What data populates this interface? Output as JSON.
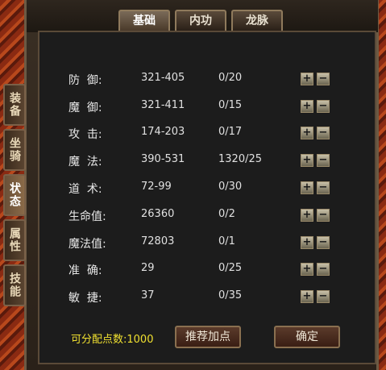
{
  "tabs": [
    "基础",
    "内功",
    "龙脉"
  ],
  "side_tabs": [
    "装备",
    "坐骑",
    "状态",
    "属性",
    "技能"
  ],
  "stats": [
    {
      "label": "防  御:",
      "value": "321-405",
      "points": "0/20"
    },
    {
      "label": "魔  御:",
      "value": "321-411",
      "points": "0/15"
    },
    {
      "label": "攻  击:",
      "value": "174-203",
      "points": "0/17"
    },
    {
      "label": "魔  法:",
      "value": "390-531",
      "points": "1320/25"
    },
    {
      "label": "道  术:",
      "value": "72-99",
      "points": "0/30"
    },
    {
      "label": "生命值:",
      "value": "26360",
      "points": "0/2"
    },
    {
      "label": "魔法值:",
      "value": "72803",
      "points": "0/1"
    },
    {
      "label": "准  确:",
      "value": "29",
      "points": "0/25"
    },
    {
      "label": "敏  捷:",
      "value": "37",
      "points": "0/35"
    }
  ],
  "buttons": {
    "plus": "+",
    "minus": "−",
    "recommend": "推荐加点",
    "confirm": "确定"
  },
  "free_points": {
    "label": "可分配点数:",
    "value": "1000"
  },
  "colors": {
    "accent_yellow": "#f0e030",
    "panel_bg": "#1c1c1c",
    "border_brown": "#8f7a5c"
  },
  "icons": {
    "plus": "plus-icon",
    "minus": "minus-icon"
  }
}
